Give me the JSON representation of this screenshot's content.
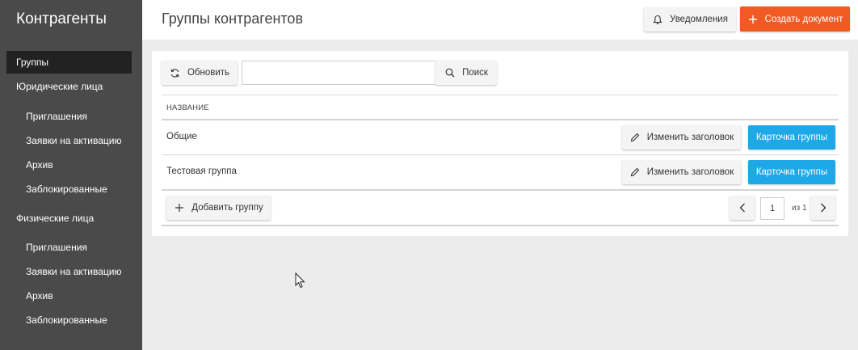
{
  "sidebar": {
    "brand": "Контрагенты",
    "items": [
      {
        "label": "Группы"
      },
      {
        "label": "Юридические лица"
      },
      {
        "label": "Приглашения"
      },
      {
        "label": "Заявки на активацию"
      },
      {
        "label": "Архив"
      },
      {
        "label": "Заблокированные"
      },
      {
        "label": "Физические лица"
      },
      {
        "label": "Приглашения"
      },
      {
        "label": "Заявки на активацию"
      },
      {
        "label": "Архив"
      },
      {
        "label": "Заблокированные"
      }
    ],
    "active_item": "Группы"
  },
  "header": {
    "title": "Группы контрагентов",
    "notifications_label": "Уведомления",
    "create_label": "Создать документ"
  },
  "toolbar": {
    "refresh_label": "Обновить",
    "search_value": "",
    "search_label": "Поиск"
  },
  "table": {
    "column_header": "НАЗВАНИЕ",
    "rows": [
      {
        "name": "Общие",
        "edit_label": "Изменить заголовок",
        "card_label": "Карточка группы"
      },
      {
        "name": "Тестовая группа",
        "edit_label": "Изменить заголовок",
        "card_label": "Карточка группы"
      }
    ]
  },
  "footer": {
    "add_label": "Добавить группу",
    "page": "1",
    "of_label": "из 1"
  },
  "colors": {
    "sidebar_bg": "#4a4a4a",
    "accent_orange": "#f15a22",
    "accent_blue": "#1ea8e7"
  }
}
